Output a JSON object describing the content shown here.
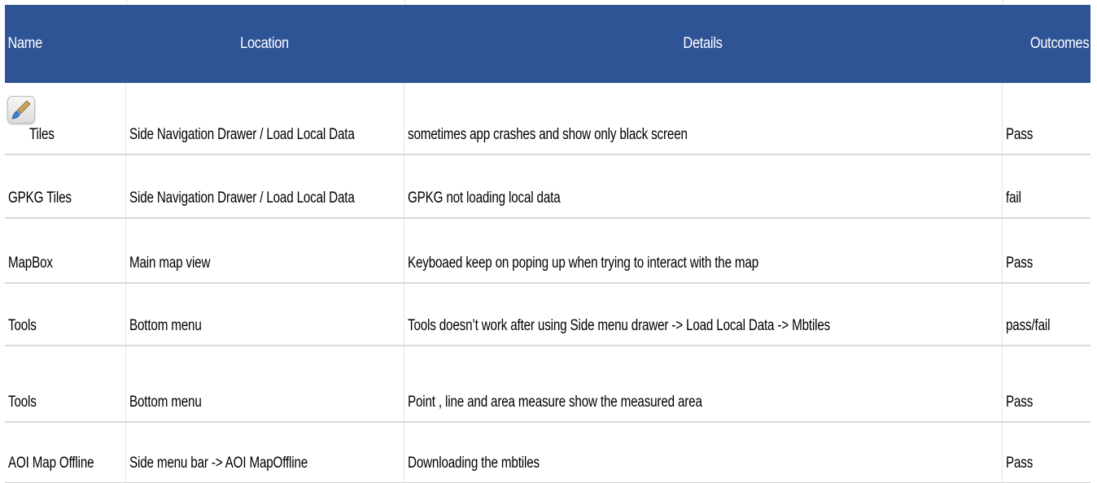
{
  "table": {
    "columns": [
      "Name",
      "Location",
      "Details",
      "Outcomes"
    ],
    "rows": [
      {
        "name": "Tiles",
        "location": "Side Navigation Drawer / Load Local Data",
        "details": "sometimes app crashes and show only black screen",
        "outcome": "Pass",
        "icon": "paintbrush-icon"
      },
      {
        "name": "GPKG Tiles",
        "location": "Side Navigation Drawer / Load Local Data",
        "details": "GPKG not loading local data",
        "outcome": "fail"
      },
      {
        "name": "MapBox",
        "location": "Main map view",
        "details": "Keyboaed keep on poping up when trying to interact with the map",
        "outcome": "Pass"
      },
      {
        "name": "Tools",
        "location": "Bottom menu",
        "details": "Tools doesn’t work after using Side menu drawer -> Load Local Data -> Mbtiles",
        "outcome": "pass/fail"
      },
      {
        "name": "Tools",
        "location": "Bottom menu",
        "details": "Point , line and area measure show the measured area",
        "outcome": "Pass"
      },
      {
        "name": "AOI Map Offline",
        "location": "Side menu bar -> AOI MapOffline",
        "details": "Downloading the mbtiles",
        "outcome": "Pass"
      }
    ]
  },
  "colors": {
    "header_bg": "#2f5496",
    "header_text": "#ffffff",
    "gridline": "#d9d9d9"
  }
}
